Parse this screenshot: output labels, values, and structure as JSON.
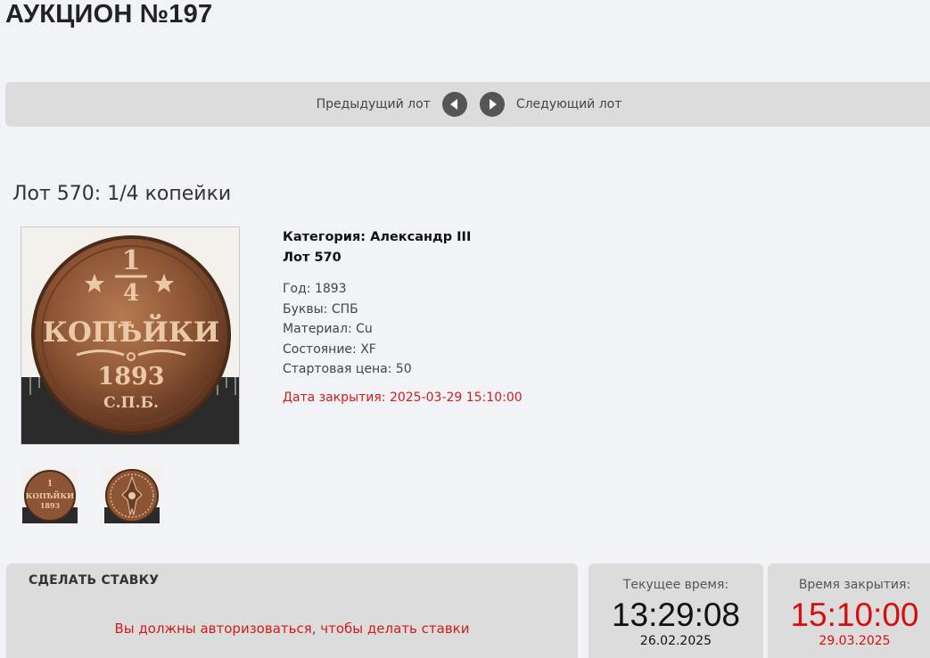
{
  "auction": {
    "title": "АУКЦИОН №197"
  },
  "nav": {
    "prev_label": "Предыдущий лот",
    "next_label": "Следующий лот"
  },
  "lot": {
    "title": "Лот 570: 1/4 копейки",
    "category": "Категория: Александр III",
    "number": "Лот 570",
    "properties": [
      "Год: 1893",
      "Буквы: СПБ",
      "Материал: Cu",
      "Состояние: XF",
      "Стартовая цена: 50"
    ],
    "close_date": "Дата закрытия: 2025-03-29 15:10:00"
  },
  "coin": {
    "numerator": "1",
    "denominator": "4",
    "word": "КОПѢЙКИ",
    "year": "1893",
    "mint": "С.П.Б.",
    "thumb_word": "КОПѢЙКИ",
    "thumb_year": "1893"
  },
  "bid": {
    "heading": "СДЕЛАТЬ СТАВКУ",
    "message": "Вы должны авторизоваться, чтобы делать ставки"
  },
  "current_time": {
    "label": "Текущее время:",
    "time": "13:29:08",
    "date": "26.02.2025"
  },
  "closing_time": {
    "label": "Время закрытия:",
    "time": "15:10:00",
    "date": "29.03.2025"
  },
  "colors": {
    "accent_red": "#d01c1c",
    "panel_grey": "#dcdcdc",
    "page_bg": "#f2f3f7"
  },
  "icons": {
    "prev": "chevron-left-circle-icon",
    "next": "chevron-right-circle-icon"
  }
}
